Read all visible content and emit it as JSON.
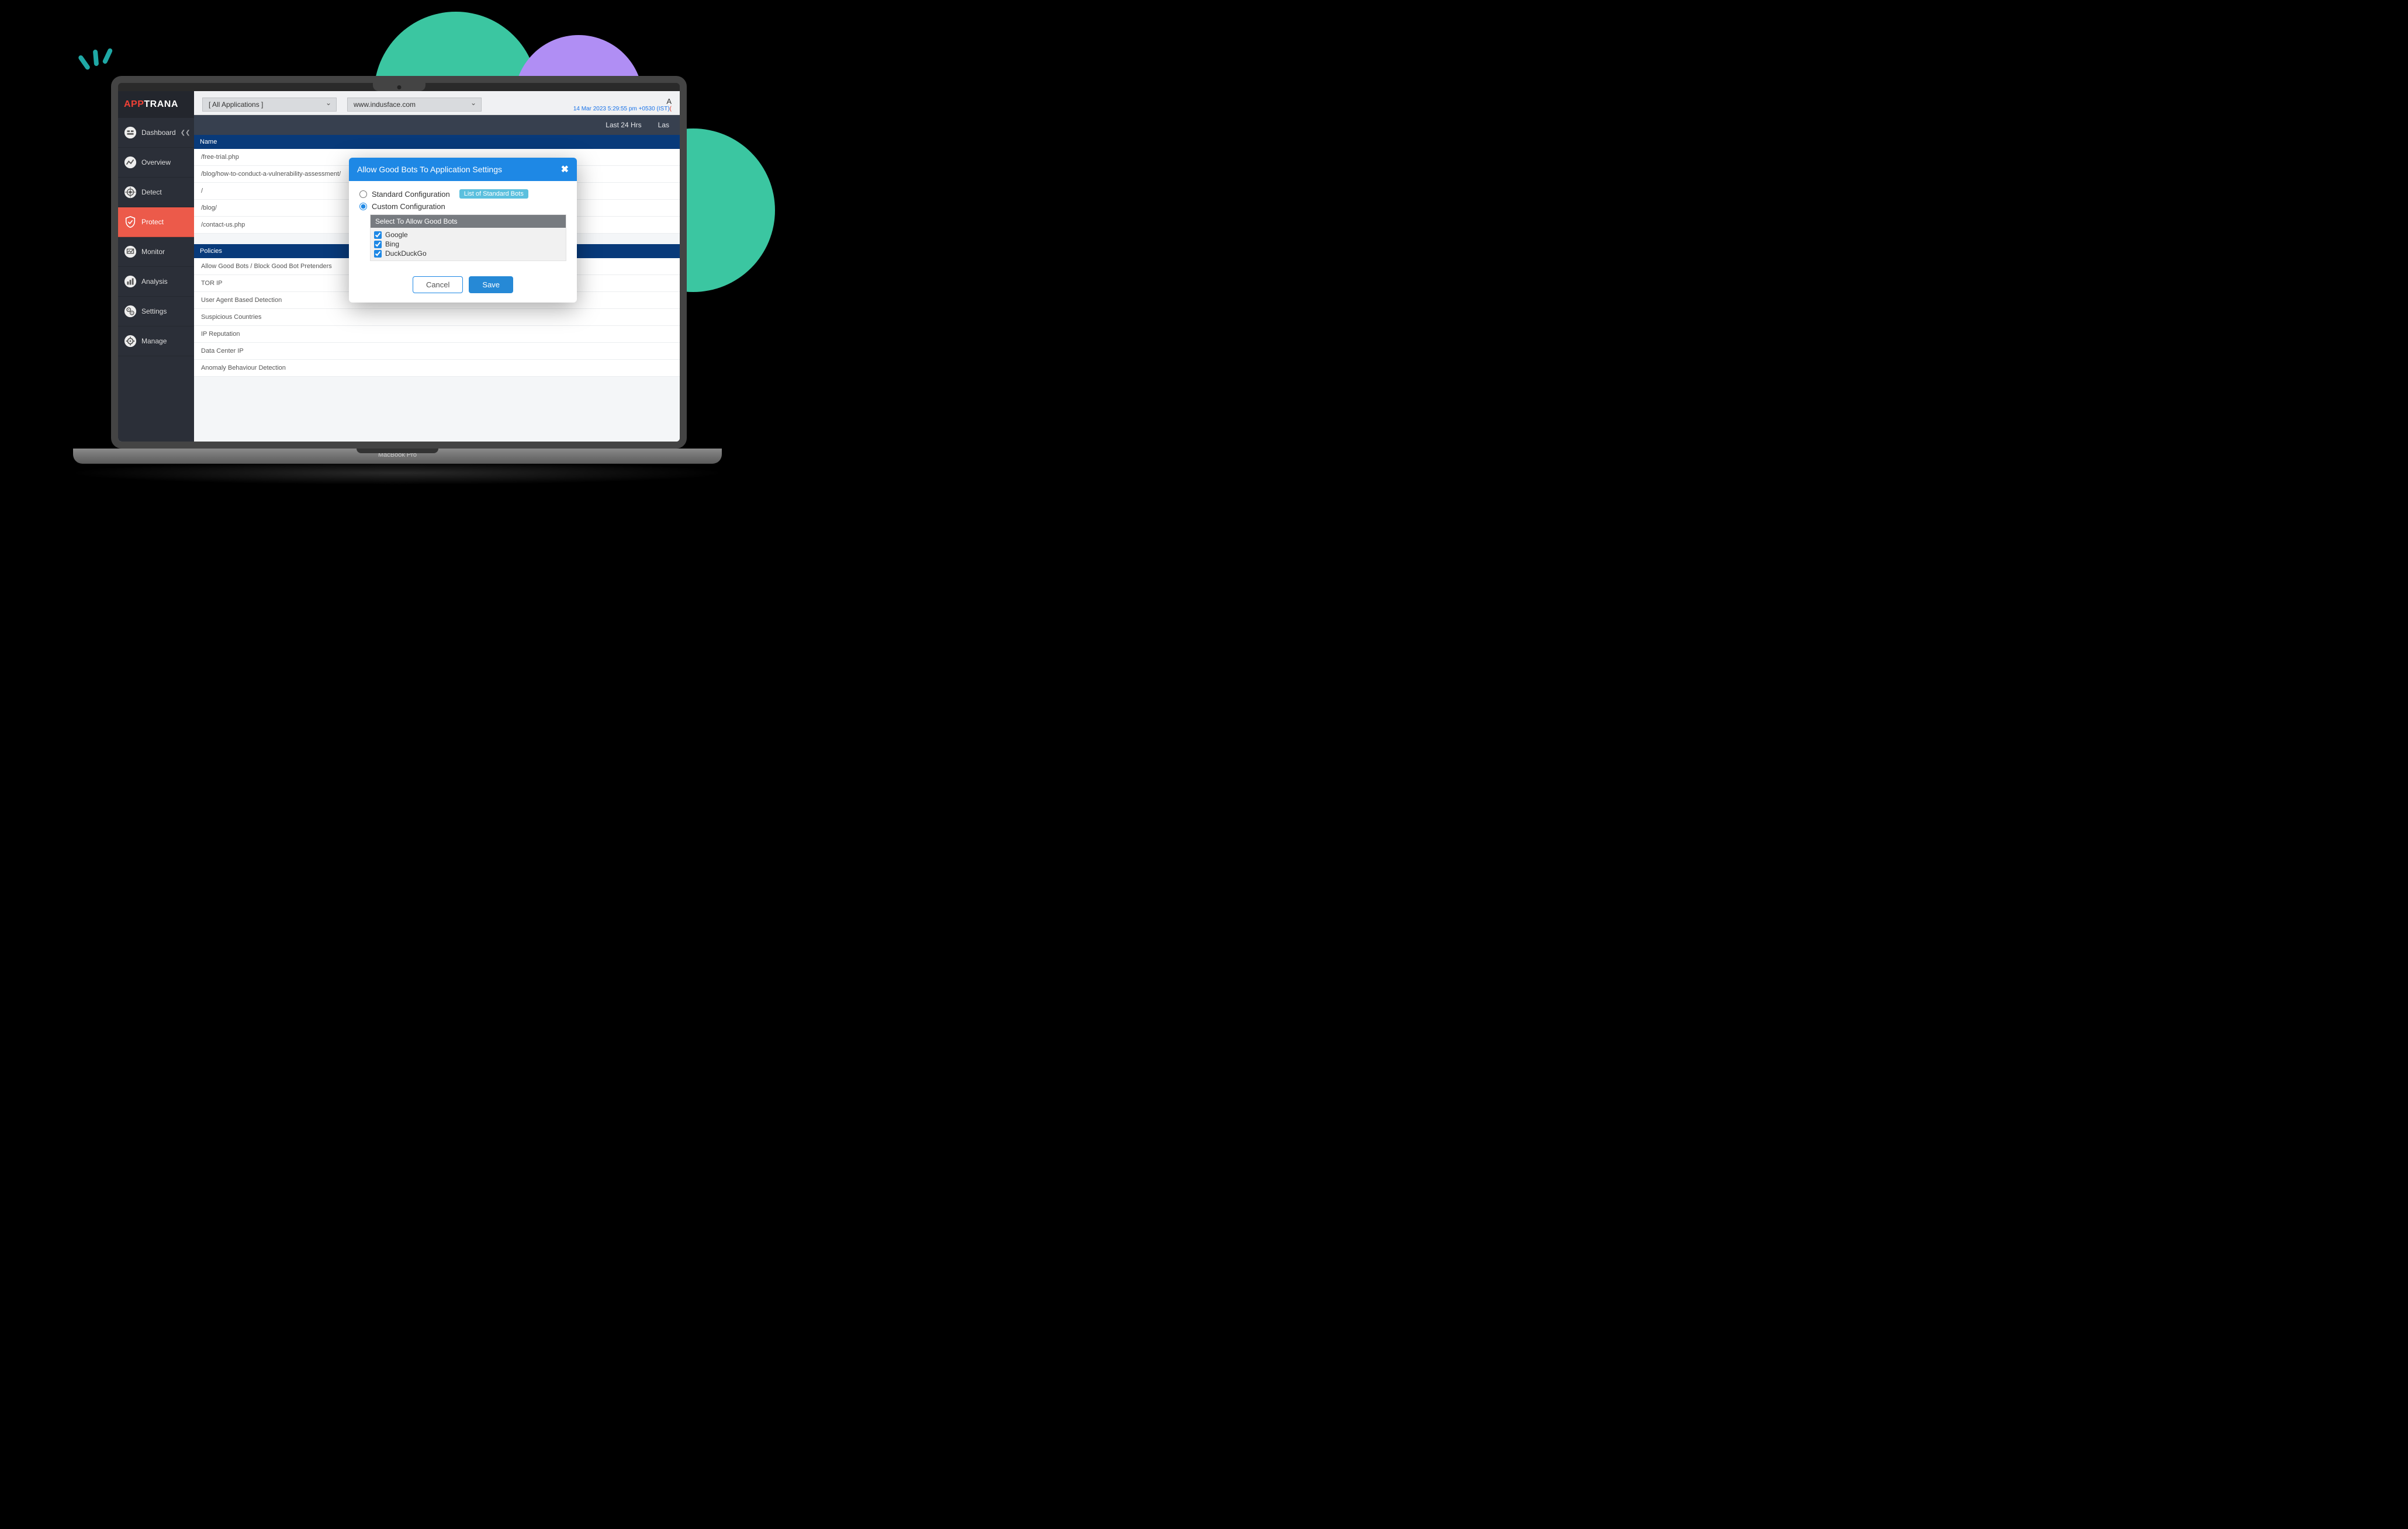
{
  "brand": {
    "part1": "APP",
    "part2": "TRANA"
  },
  "sidebar": {
    "items": [
      {
        "label": "Dashboard",
        "has_chevron": true
      },
      {
        "label": "Overview"
      },
      {
        "label": "Detect"
      },
      {
        "label": "Protect",
        "active": true
      },
      {
        "label": "Monitor"
      },
      {
        "label": "Analysis"
      },
      {
        "label": "Settings"
      },
      {
        "label": "Manage"
      }
    ]
  },
  "topbar": {
    "all_apps": "[ All Applications ]",
    "site": "www.indusface.com",
    "account_initial": "A",
    "timestamp": "14 Mar 2023 5:29:55 pm +0530 (IST)",
    "timestamp_suffix": "("
  },
  "subbar": {
    "tabs": [
      "Last 24 Hrs",
      "Las"
    ]
  },
  "names_header": "Name",
  "names": [
    "/free-trial.php",
    "/blog/how-to-conduct-a-vulnerability-assessment/",
    "/",
    "/blog/",
    "/contact-us.php"
  ],
  "policies_header": "Policies",
  "policies": [
    "Allow Good Bots / Block Good Bot Pretenders",
    "TOR IP",
    "User Agent Based Detection",
    "Suspicious Countries",
    "IP Reputation",
    "Data Center IP",
    "Anomaly Behaviour Detection"
  ],
  "modal": {
    "title": "Allow Good Bots To Application Settings",
    "close": "✖",
    "option_standard": "Standard Configuration",
    "option_custom": "Custom Configuration",
    "standard_list_badge": "List of Standard Bots",
    "bots_header": "Select To Allow Good Bots",
    "bots": [
      "Google",
      "Bing",
      "DuckDuckGo"
    ],
    "cancel": "Cancel",
    "save": "Save"
  },
  "laptop_label": "MacBook Pro"
}
